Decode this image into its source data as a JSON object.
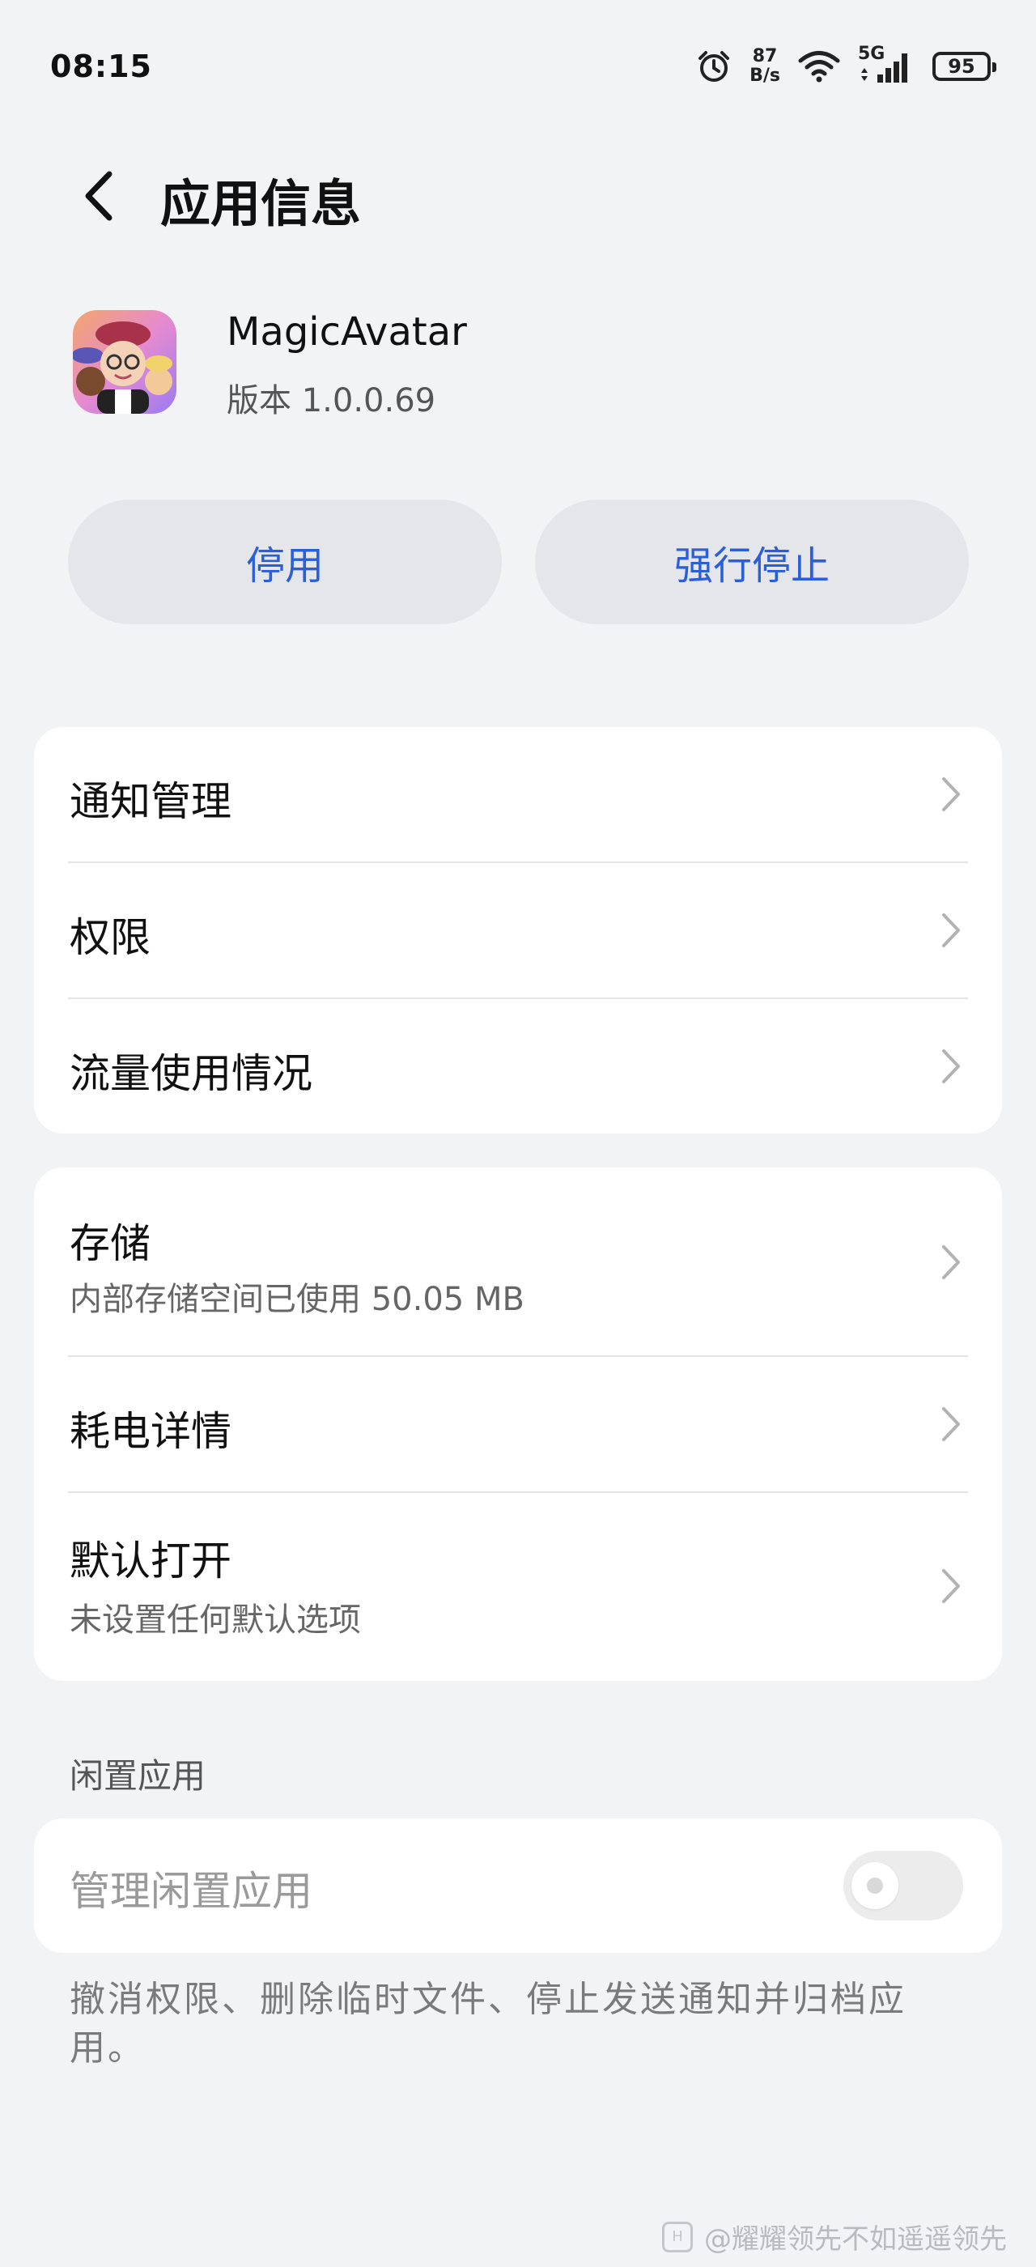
{
  "status_bar": {
    "time": "08:15",
    "net_speed_value": "87",
    "net_speed_unit": "B/s",
    "network_type": "5G",
    "battery_level": "95",
    "icons": [
      "alarm-icon",
      "wifi-icon",
      "signal-icon",
      "battery-icon"
    ]
  },
  "header": {
    "title": "应用信息",
    "back_icon": "back-arrow-icon"
  },
  "app": {
    "name": "MagicAvatar",
    "version": "版本 1.0.0.69"
  },
  "actions": {
    "disable_label": "停用",
    "force_stop_label": "强行停止",
    "accent_color": "#2b5fd9"
  },
  "group1": [
    {
      "title": "通知管理"
    },
    {
      "title": "权限"
    },
    {
      "title": "流量使用情况"
    }
  ],
  "group2": [
    {
      "title": "存储",
      "subtitle": "内部存储空间已使用 50.05 MB"
    },
    {
      "title": "耗电详情"
    },
    {
      "title": "默认打开",
      "subtitle": "未设置任何默认选项"
    }
  ],
  "idle": {
    "section_label": "闲置应用",
    "toggle_label": "管理闲置应用",
    "toggle_state": "off",
    "description": "撤消权限、删除临时文件、停止发送通知并归档应用。"
  },
  "watermark": {
    "text": "@耀耀领先不如遥遥领先"
  }
}
